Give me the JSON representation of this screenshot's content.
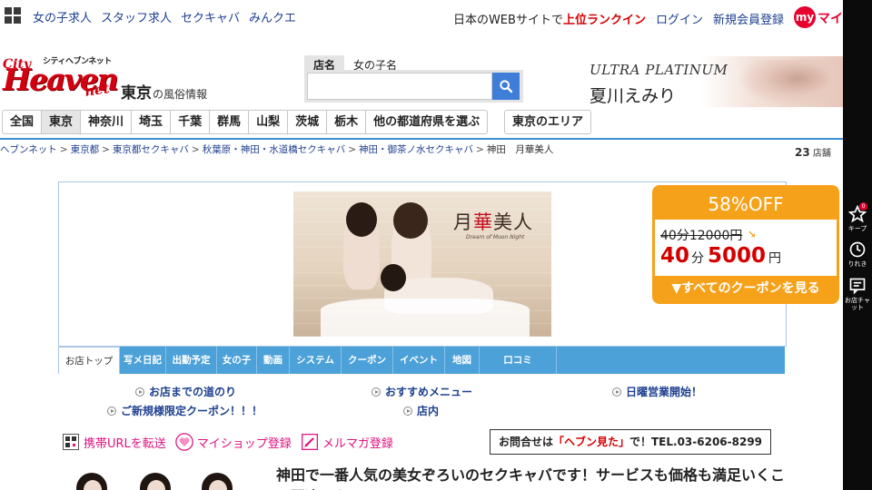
{
  "topnav": {
    "links": [
      "女の子求人",
      "スタッフ求人",
      "セクキャバ",
      "みんクエ"
    ],
    "rank_text": "日本のWEBサイトで",
    "rank_highlight": "上位ランクイン",
    "login": "ログイン",
    "register": "新規会員登録",
    "my_badge": "my",
    "my_text": "マイ"
  },
  "logo": {
    "small_text": "シティヘブンネット",
    "city": "City",
    "heaven": "Heaven",
    "net": "net"
  },
  "region": {
    "name": "東京",
    "suffix": "の風俗情報"
  },
  "search": {
    "tabs": [
      "店名",
      "女の子名"
    ],
    "value": "",
    "placeholder": ""
  },
  "banner": {
    "brand": "ULTRA PLATINUM",
    "name": "夏川えみり"
  },
  "prefectures": [
    "全国",
    "東京",
    "神奈川",
    "埼玉",
    "千葉",
    "群馬",
    "山梨",
    "茨城",
    "栃木",
    "他の都道府県を選ぶ"
  ],
  "active_prefecture": "東京",
  "area_button": "東京のエリア",
  "breadcrumb": [
    "ヘブンネット",
    "東京都",
    "東京都セクキャバ",
    "秋葉原・神田・水道橋セクキャバ",
    "神田・御茶ノ水セクキャバ",
    "神田　月華美人"
  ],
  "shop_count": {
    "num": "23",
    "unit": "店舗"
  },
  "shop": {
    "logo_pre": "月",
    "logo_mid": "華",
    "logo_post": "美人",
    "logo_sub": "Dream of Moon Night"
  },
  "coupon": {
    "discount": "58%OFF",
    "original": "40分12000円",
    "arrow": "↘",
    "new_min": "40",
    "min_unit": "分",
    "new_price": "5000",
    "yen": "円",
    "all_link": "▼すべてのクーポンを見る"
  },
  "shop_tabs": [
    "お店トップ",
    "写メ日記",
    "出勤予定",
    "女の子",
    "動画",
    "システム",
    "クーポン",
    "イベント",
    "地図",
    "口コミ"
  ],
  "feature_links": [
    "お店までの道のり",
    "おすすめメニュー",
    "日曜営業開始！",
    "ご新規様限定クーポン！！！",
    "店内"
  ],
  "utilities": [
    "携帯URLを転送",
    "マイショップ登録",
    "メルマガ登録"
  ],
  "contact": {
    "pre": "お問合せは",
    "highlight": "「ヘブン見た」",
    "post": "で！TEL.03-6206-8299"
  },
  "catchcopy": "神田で一番人気の美女ぞろいのセクキャバです！サービスも価格も満足いくこと間違いなし！",
  "rightbar": {
    "keep_label": "キープ",
    "keep_count": "0",
    "history_label": "りれき",
    "chat_label": "お店チャット"
  },
  "colors": {
    "brand_red": "#d40012",
    "nav_blue": "#1d3f8f",
    "tab_blue": "#4ba1d8",
    "coupon_orange": "#f6a11a",
    "pink_link": "#e0117e"
  }
}
